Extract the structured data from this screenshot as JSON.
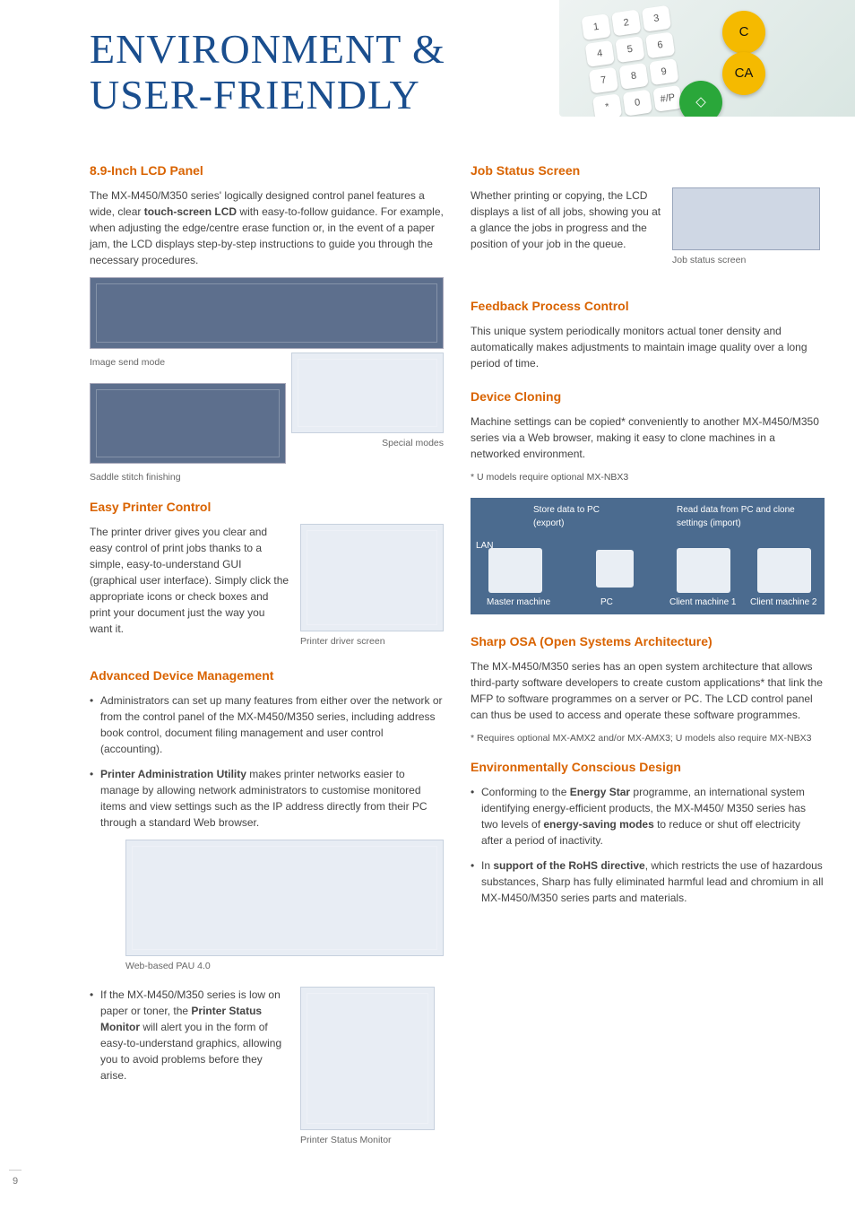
{
  "page_title_line1": "ENVIRONMENT &",
  "page_title_line2": "USER-FRIENDLY",
  "page_number": "9",
  "keypad": {
    "clear": "C",
    "clear_all": "CA",
    "start": "◇"
  },
  "left": {
    "lcd": {
      "heading": "8.9-Inch LCD Panel",
      "body": "The MX-M450/M350 series' logically designed control panel features a wide, clear ",
      "body_strong": "touch-screen LCD",
      "body_after": " with easy-to-follow guidance. For example, when adjusting the edge/centre erase function or, in the event of a paper jam, the LCD displays step-by-step instructions to guide you through the necessary procedures.",
      "caption_image_send": "Image send mode",
      "caption_special": "Special modes",
      "caption_saddle": "Saddle stitch finishing"
    },
    "easy_printer": {
      "heading": "Easy Printer Control",
      "body": "The printer driver gives you clear and easy control of print jobs thanks to a simple, easy-to-understand GUI (graphical user interface). Simply click the appropriate icons or check boxes and print your document just the way you want it.",
      "caption": "Printer driver screen"
    },
    "adv_device": {
      "heading": "Advanced Device Management",
      "bullet1": "Administrators can set up many features from either over the network or from the control panel of the MX-M450/M350 series, including address book control, document filing management and user control (accounting).",
      "bullet2_strong": "Printer Administration Utility",
      "bullet2_after": " makes printer networks easier to manage by allowing network administrators to customise monitored items and view settings such as the IP address directly from their PC through a standard Web browser.",
      "caption_pau": "Web-based PAU 4.0",
      "bullet3_before": "If the MX-M450/M350 series is low on paper or toner, the ",
      "bullet3_strong": "Printer Status Monitor",
      "bullet3_after": " will alert you in the form of easy-to-understand graphics, allowing you to avoid problems before they arise.",
      "caption_psm": "Printer Status Monitor"
    }
  },
  "right": {
    "job_status": {
      "heading": "Job Status Screen",
      "body": "Whether printing or copying, the LCD displays a list of all jobs, showing you at a glance the jobs in progress and the position of your job in the queue.",
      "caption": "Job status screen"
    },
    "feedback": {
      "heading": "Feedback Process Control",
      "body": "This unique system periodically monitors actual toner density and automatically makes adjustments to maintain image quality over a long period of time."
    },
    "cloning": {
      "heading": "Device Cloning",
      "body": "Machine settings can be copied* conveniently to another MX-M450/M350 series via a Web browser, making it easy to clone machines in a networked environment.",
      "footnote": "* U models require optional MX-NBX3",
      "diagram": {
        "lan": "LAN",
        "store": "Store data to PC (export)",
        "read": "Read data from PC and clone settings (import)",
        "master": "Master machine",
        "pc": "PC",
        "client1": "Client machine 1",
        "client2": "Client machine 2"
      }
    },
    "osa": {
      "heading": "Sharp OSA (Open Systems Architecture)",
      "body": "The MX-M450/M350 series has an open system architecture that allows third-party software developers to create custom applications* that link the MFP to software programmes on a server or PC. The LCD control panel can thus be used to access and operate these software programmes.",
      "footnote": "* Requires optional MX-AMX2 and/or MX-AMX3; U models also require MX-NBX3"
    },
    "env": {
      "heading": "Environmentally Conscious Design",
      "bullet1_before": "Conforming to the ",
      "bullet1_strong": "Energy Star",
      "bullet1_mid": " programme, an international system identifying energy-efficient products, the MX-M450/ M350 series has two levels of ",
      "bullet1_strong2": "energy-saving modes",
      "bullet1_after": " to reduce or shut off electricity after a period of inactivity.",
      "bullet2_before": "In ",
      "bullet2_strong": "support of the RoHS directive",
      "bullet2_after": ", which restricts the use of hazardous substances, Sharp has fully eliminated harmful lead and chromium in all MX-M450/M350 series parts and materials."
    }
  }
}
